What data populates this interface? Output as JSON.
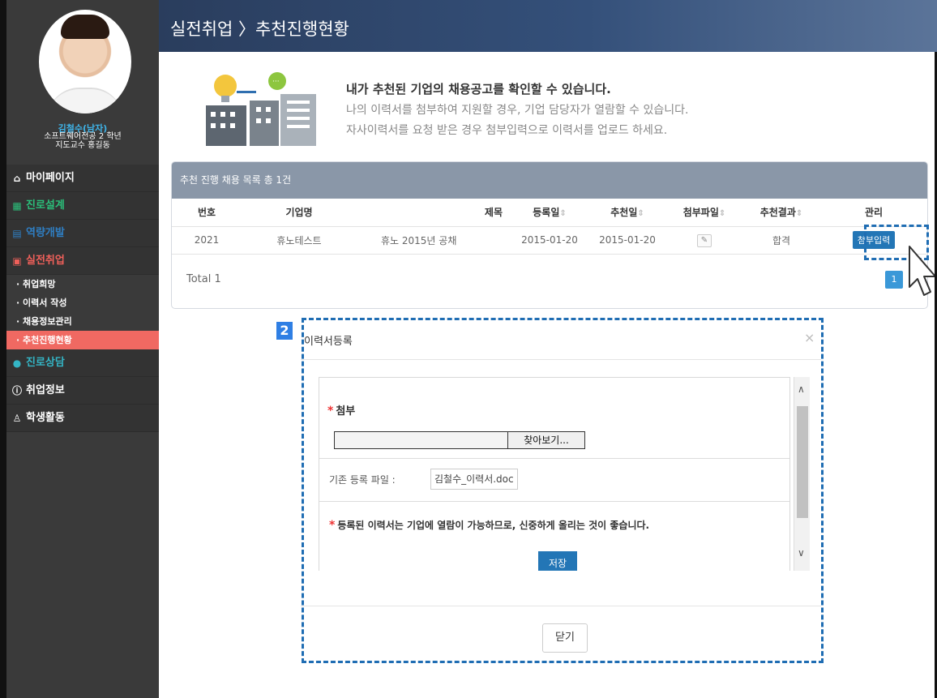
{
  "header": {
    "title": "실전취업 〉추천진행현황"
  },
  "profile": {
    "name": "김철수(남자)",
    "dept": "소프트웨어전공 2 학년",
    "advisor": "지도교수 홍길동"
  },
  "nav": {
    "items": [
      {
        "label": "마이페이지",
        "icon": "home-icon"
      },
      {
        "label": "진로설계",
        "icon": "compass-icon"
      },
      {
        "label": "역량개발",
        "icon": "chart-icon"
      },
      {
        "label": "실전취업",
        "icon": "briefcase-icon"
      }
    ],
    "sub_items": [
      {
        "label": "· 취업희망"
      },
      {
        "label": "· 이력서 작성"
      },
      {
        "label": "· 채용정보관리"
      },
      {
        "label": "· 추천진행현황"
      }
    ],
    "items_after": [
      {
        "label": "진로상담",
        "icon": "chat-icon"
      },
      {
        "label": "취업정보",
        "icon": "info-icon"
      },
      {
        "label": "학생활동",
        "icon": "people-icon"
      }
    ]
  },
  "intro": {
    "title": "내가 추천된 기업의 채용공고를 확인할 수 있습니다.",
    "line1": "나의 이력서를 첨부하여 지원할 경우, 기업 담당자가 열람할 수 있습니다.",
    "line2": "자사이력서를 요청 받은 경우 첨부입력으로 이력서를 업로드 하세요."
  },
  "table": {
    "header_text": "추천 진행 채용 목록 총 1건",
    "columns": [
      "번호",
      "기업명",
      "제목",
      "등록일",
      "추천일",
      "첨부파일",
      "추천결과",
      "관리"
    ],
    "sort_icon": "⇕",
    "rows": [
      {
        "no": "2021",
        "company": "휴노테스트",
        "title": "휴노 2015년 공채",
        "reg_date": "2015-01-20",
        "rec_date": "2015-01-20",
        "result": "합격",
        "action": "첨부입력"
      }
    ],
    "total": "Total 1",
    "page": "1"
  },
  "callout": {
    "number": "2"
  },
  "modal": {
    "title": "이력서등록",
    "close_x": "×",
    "attach_label": "첨부",
    "browse_button": "찾아보기...",
    "existing_label": "기존 등록 파일 :",
    "existing_file": "김철수_이력서.doc",
    "notice": "등록된 이력서는 기업에 열람이 가능하므로, 신중하게 올리는 것이 좋습니다.",
    "save_button": "저장",
    "close_button": "닫기"
  },
  "colors": {
    "sidebar_bg": "#3a3a3a",
    "active_menu": "#f06962",
    "header_gradient_start": "#2a3d5d",
    "primary_button": "#2376b6",
    "callout_dash": "#1f6db3"
  }
}
